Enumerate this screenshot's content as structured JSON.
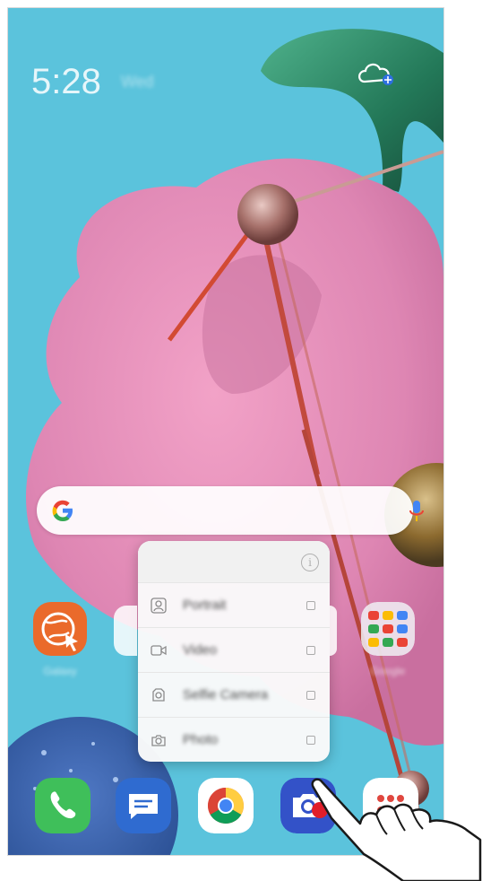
{
  "status": {
    "time": "5:28",
    "date": "Wed"
  },
  "search": {
    "logo_letter": "G"
  },
  "popup": {
    "info_glyph": "i",
    "items": [
      {
        "label": "Portrait",
        "icon": "portrait-icon"
      },
      {
        "label": "Video",
        "icon": "video-icon"
      },
      {
        "label": "Selfie Camera",
        "icon": "selfie-camera-icon"
      },
      {
        "label": "Photo",
        "icon": "photo-icon"
      }
    ]
  },
  "home_apps": [
    {
      "label": "Galaxy",
      "icon": "browser-globe-icon"
    },
    {
      "label": "Google",
      "icon": "google-folder-icon"
    }
  ],
  "dock": [
    {
      "icon": "phone-icon"
    },
    {
      "icon": "messages-icon"
    },
    {
      "icon": "chrome-icon"
    },
    {
      "icon": "camera-icon"
    },
    {
      "icon": "apps-drawer-icon"
    }
  ],
  "colors": {
    "sky": "#5bc3dc",
    "blob": "#e48cb6",
    "torus": "#2f8b6b",
    "phone_app": "#3fbf5a",
    "messages_app": "#2f6bd0",
    "camera_app": "#3352c8"
  }
}
